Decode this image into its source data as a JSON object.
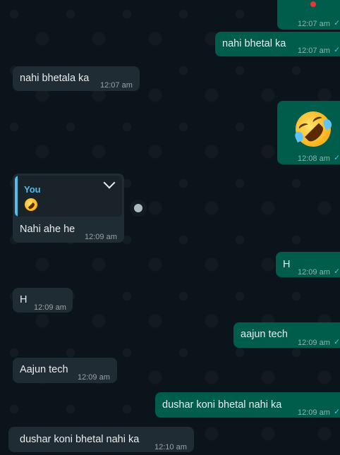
{
  "messages": [
    {
      "dir": "out",
      "text": "",
      "time": "12:07 am"
    },
    {
      "dir": "out",
      "text": "nahi bhetal ka",
      "time": "12:07 am"
    },
    {
      "dir": "in",
      "text": "nahi bhetala ka",
      "time": "12:07 am"
    },
    {
      "dir": "out",
      "text": "",
      "time": "12:08 am",
      "emoji": "rolling-on-floor-laughing"
    },
    {
      "dir": "in",
      "reply_author": "You",
      "reply_emoji": "rolling-on-floor-laughing",
      "text": "Nahi ahe he",
      "time": "12:09 am"
    },
    {
      "dir": "out",
      "text": "H",
      "time": "12:09 am"
    },
    {
      "dir": "in",
      "text": "H",
      "time": "12:09 am"
    },
    {
      "dir": "out",
      "text": "aajun tech",
      "time": "12:09 am"
    },
    {
      "dir": "in",
      "text": "Aajun tech",
      "time": "12:09 am"
    },
    {
      "dir": "out",
      "text": "dushar koni bhetal nahi ka",
      "time": "12:09 am"
    },
    {
      "dir": "in",
      "text": "dushar koni bhetal nahi ka",
      "time": "12:10 am"
    }
  ],
  "colors": {
    "incoming": "#202c33",
    "outgoing": "#005c4b",
    "background": "#0b141a",
    "reply_accent": "#53bdeb"
  },
  "icons": {
    "read_receipt": "double-check-icon",
    "reaction": "emoji-icon",
    "menu": "chevron-down-icon"
  }
}
